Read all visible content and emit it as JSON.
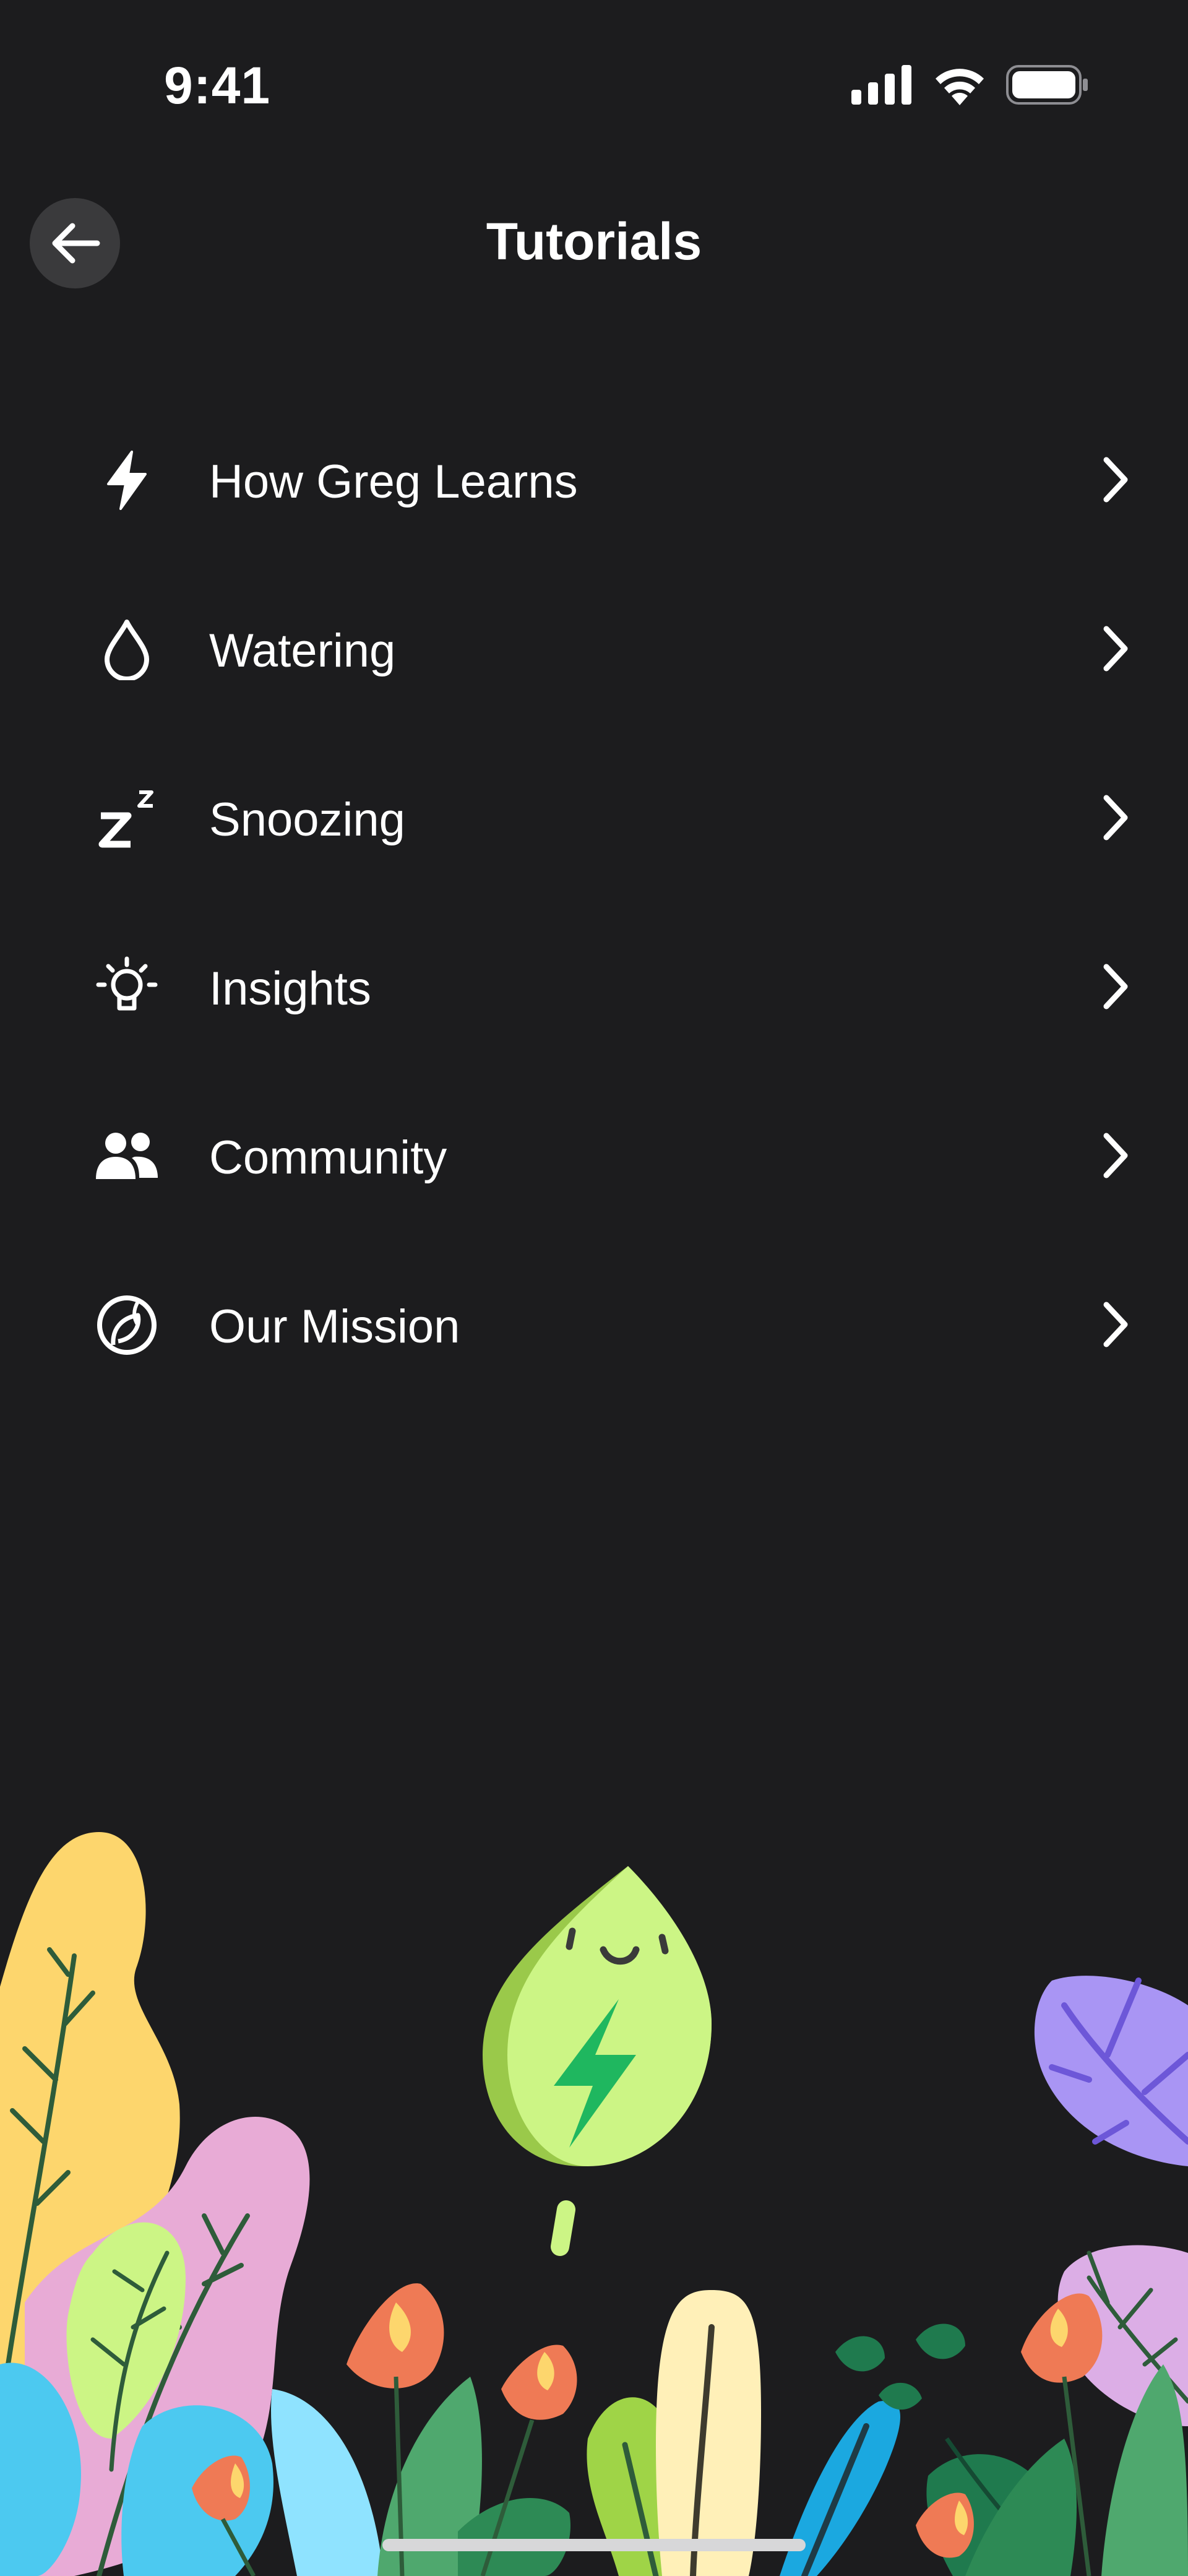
{
  "status": {
    "time": "9:41"
  },
  "header": {
    "title": "Tutorials"
  },
  "menu": {
    "items": [
      {
        "label": "How Greg Learns",
        "icon": "bolt-icon"
      },
      {
        "label": "Watering",
        "icon": "droplet-icon"
      },
      {
        "label": "Snoozing",
        "icon": "zz-icon"
      },
      {
        "label": "Insights",
        "icon": "lightbulb-icon"
      },
      {
        "label": "Community",
        "icon": "people-icon"
      },
      {
        "label": "Our Mission",
        "icon": "globe-leaf-icon"
      }
    ]
  },
  "colors": {
    "background": "#1c1c1e",
    "back_button": "#3a3a3c",
    "leaf_mascot": "#ccf585",
    "leaf_mascot_shadow": "#9ac94a",
    "leaf_bolt": "#1fb75f"
  }
}
